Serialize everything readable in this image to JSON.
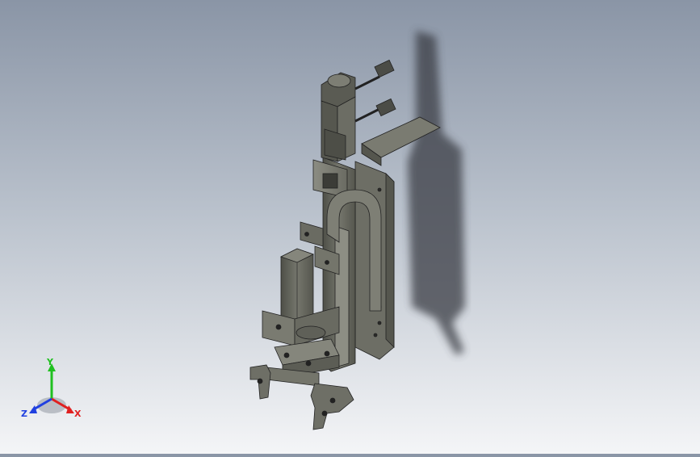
{
  "viewport": {
    "background_top": "#8a95a6",
    "background_bottom": "#f4f5f7",
    "model_color": "#6b6c62",
    "shadow_color": "#3a3d44"
  },
  "triad": {
    "x_label": "X",
    "y_label": "Y",
    "z_label": "Z",
    "x_color": "#e02020",
    "y_color": "#20c020",
    "z_color": "#2040e0"
  }
}
